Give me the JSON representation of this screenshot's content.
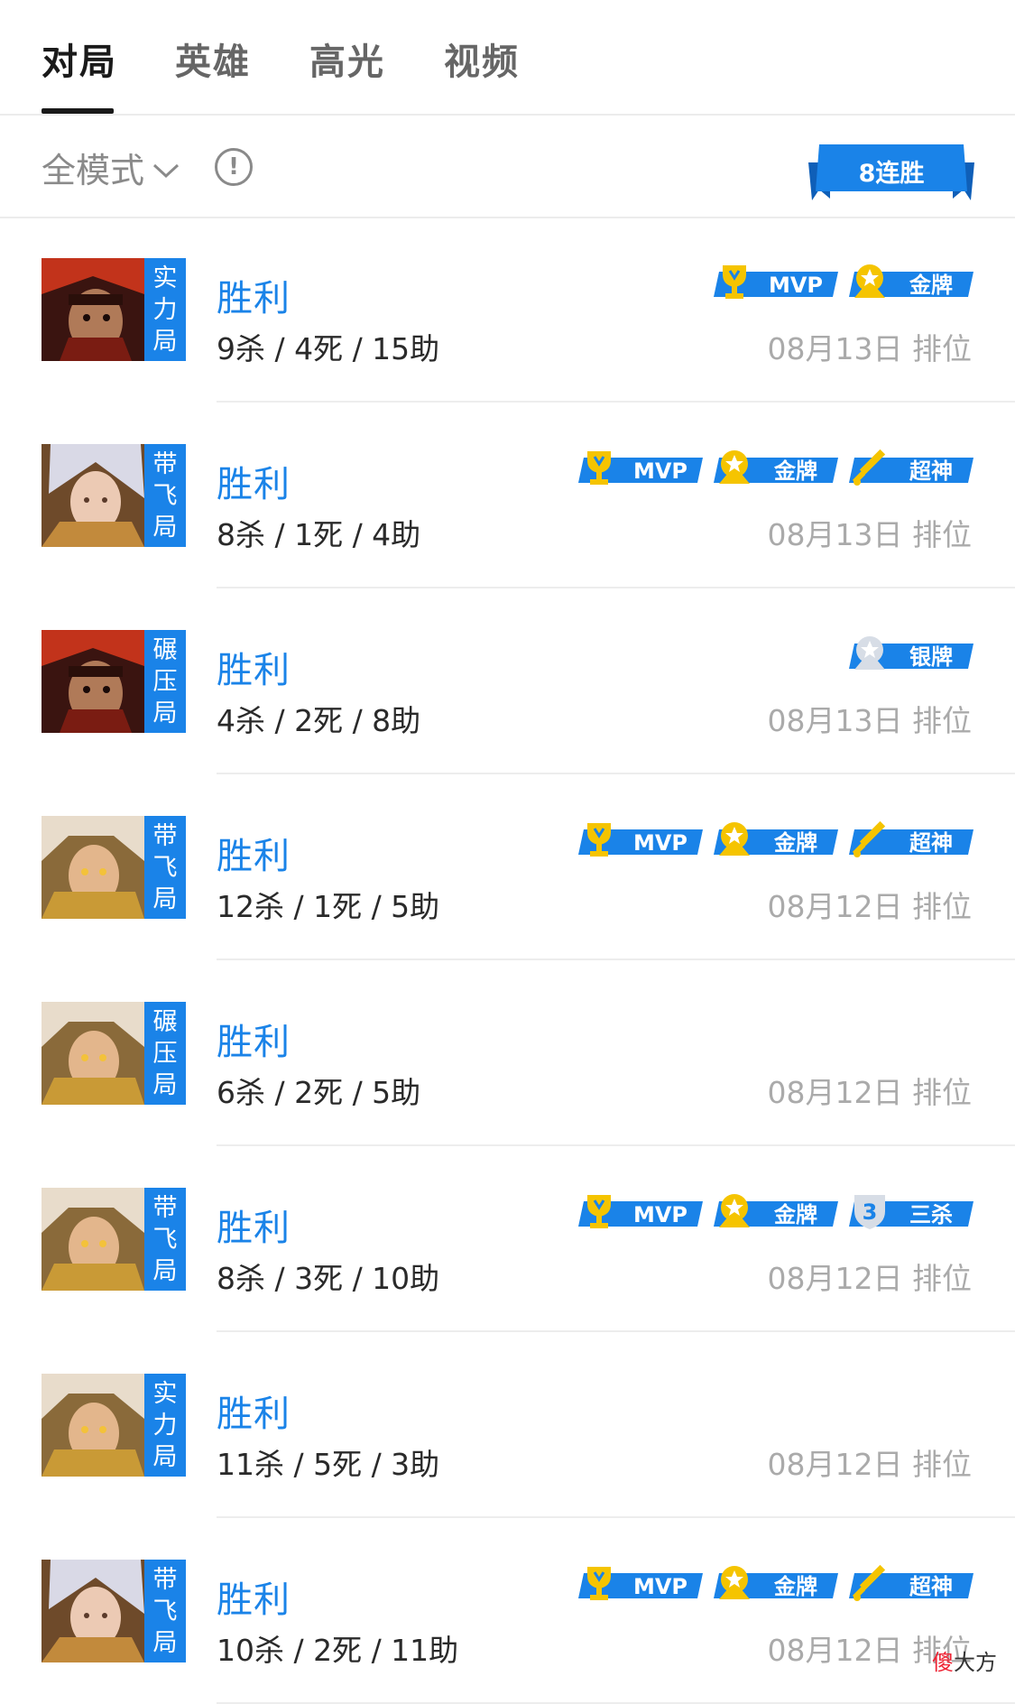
{
  "tabs": [
    {
      "label": "对局",
      "active": true
    },
    {
      "label": "英雄",
      "active": false
    },
    {
      "label": "高光",
      "active": false
    },
    {
      "label": "视频",
      "active": false
    }
  ],
  "filter": {
    "mode_label": "全模式",
    "info_icon": "info-circle-icon",
    "streak_label": "8连胜"
  },
  "matches": [
    {
      "hero": "hero-a",
      "tag": [
        "实",
        "力",
        "局"
      ],
      "result": "胜利",
      "kda": "9杀 / 4死 / 15助",
      "date": "08月13日 排位",
      "badges": [
        {
          "type": "mvp",
          "label": "MVP"
        },
        {
          "type": "gold",
          "label": "金牌"
        }
      ]
    },
    {
      "hero": "hero-b",
      "tag": [
        "带",
        "飞",
        "局"
      ],
      "result": "胜利",
      "kda": "8杀 / 1死 / 4助",
      "date": "08月13日 排位",
      "badges": [
        {
          "type": "mvp",
          "label": "MVP"
        },
        {
          "type": "gold",
          "label": "金牌"
        },
        {
          "type": "legend",
          "label": "超神"
        }
      ]
    },
    {
      "hero": "hero-a",
      "tag": [
        "碾",
        "压",
        "局"
      ],
      "result": "胜利",
      "kda": "4杀 / 2死 / 8助",
      "date": "08月13日 排位",
      "badges": [
        {
          "type": "silver",
          "label": "银牌"
        }
      ]
    },
    {
      "hero": "hero-c",
      "tag": [
        "带",
        "飞",
        "局"
      ],
      "result": "胜利",
      "kda": "12杀 / 1死 / 5助",
      "date": "08月12日 排位",
      "badges": [
        {
          "type": "mvp",
          "label": "MVP"
        },
        {
          "type": "gold",
          "label": "金牌"
        },
        {
          "type": "legend",
          "label": "超神"
        }
      ]
    },
    {
      "hero": "hero-c",
      "tag": [
        "碾",
        "压",
        "局"
      ],
      "result": "胜利",
      "kda": "6杀 / 2死 / 5助",
      "date": "08月12日 排位",
      "badges": []
    },
    {
      "hero": "hero-c",
      "tag": [
        "带",
        "飞",
        "局"
      ],
      "result": "胜利",
      "kda": "8杀 / 3死 / 10助",
      "date": "08月12日 排位",
      "badges": [
        {
          "type": "mvp",
          "label": "MVP"
        },
        {
          "type": "gold",
          "label": "金牌"
        },
        {
          "type": "triple",
          "label": "三杀"
        }
      ]
    },
    {
      "hero": "hero-c",
      "tag": [
        "实",
        "力",
        "局"
      ],
      "result": "胜利",
      "kda": "11杀 / 5死 / 3助",
      "date": "08月12日 排位",
      "badges": []
    },
    {
      "hero": "hero-b",
      "tag": [
        "带",
        "飞",
        "局"
      ],
      "result": "胜利",
      "kda": "10杀 / 2死 / 11助",
      "date": "08月12日 排位",
      "badges": [
        {
          "type": "mvp",
          "label": "MVP"
        },
        {
          "type": "gold",
          "label": "金牌"
        },
        {
          "type": "legend",
          "label": "超神"
        }
      ]
    }
  ],
  "watermark": {
    "char1": "傻",
    "rest": "大方"
  },
  "colors": {
    "accent": "#1a83e8",
    "gold": "#f5c400",
    "silver": "#d7dde6"
  }
}
